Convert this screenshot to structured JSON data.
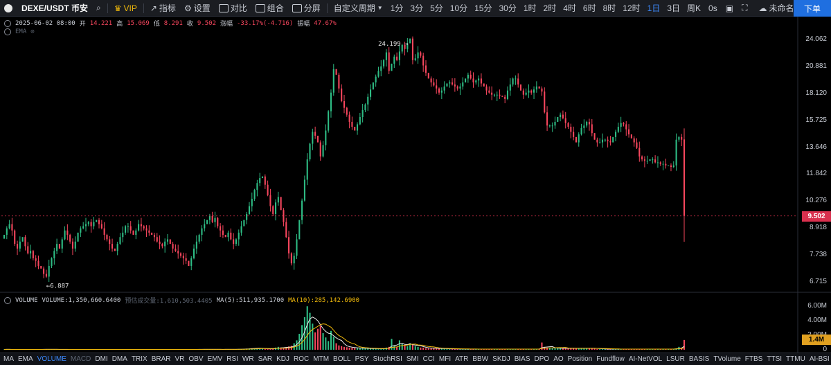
{
  "toolbar": {
    "symbol": "DEXE/USDT 币安",
    "vip": "VIP",
    "indicators": "指标",
    "settings": "设置",
    "compare": "对比",
    "combo": "组合",
    "split": "分屏",
    "custom_period": "自定义周期",
    "periods": [
      "1分",
      "3分",
      "5分",
      "10分",
      "15分",
      "30分",
      "1时",
      "2时",
      "4时",
      "6时",
      "8时",
      "12时",
      "1日",
      "3日",
      "周K"
    ],
    "active_period": "1日",
    "interval": "0s",
    "layout_name": "未命名",
    "order_button": "下单"
  },
  "ohlc": {
    "date": "2025-06-02 08:00",
    "open_label": "开",
    "open": "14.221",
    "high_label": "高",
    "high": "15.069",
    "low_label": "低",
    "low": "8.291",
    "close_label": "收",
    "close": "9.502",
    "change_label": "涨幅",
    "change": "-33.17%(-4.716)",
    "amplitude_label": "振幅",
    "amplitude": "47.67%"
  },
  "ema_label": "EMA",
  "volume_legend": {
    "title": "VOLUME",
    "volume": "VOLUME:1,350,660.6400",
    "est_volume": "预估成交量:1,610,503.4405",
    "ma5": "MA(5):511,935.1700",
    "ma10": "MA(10):285,142.6900"
  },
  "price_axis": [
    "24.062",
    "20.881",
    "18.120",
    "15.725",
    "13.646",
    "11.842",
    "10.276",
    "8.918",
    "7.738",
    "6.715"
  ],
  "current_price": "9.502",
  "volume_axis": [
    "6.00M",
    "4.00M",
    "2.00M",
    "0"
  ],
  "volume_tag": "1.4M",
  "annotations": {
    "high": "24.199",
    "low": "6.887"
  },
  "indicator_tabs": [
    "MA",
    "EMA",
    "VOLUME",
    "MACD",
    "DMI",
    "DMA",
    "TRIX",
    "BRAR",
    "VR",
    "OBV",
    "EMV",
    "RSI",
    "WR",
    "SAR",
    "KDJ",
    "ROC",
    "MTM",
    "BOLL",
    "PSY",
    "StochRSI",
    "SMI",
    "CCI",
    "MFI",
    "ATR",
    "BBW",
    "SKDJ",
    "BIAS",
    "DPO",
    "AO",
    "Position",
    "Fundflow",
    "AI-NetVOL",
    "LSUR",
    "BASIS",
    "TVolume",
    "FTBS",
    "TTSI",
    "TTMU",
    "AI-BSI"
  ],
  "active_indicator": "VOLUME",
  "dim_indicator": "MACD",
  "colors": {
    "up": "#2ebd85",
    "down": "#f6465d",
    "accent": "#3d8bff",
    "ma5": "#e8e8e8",
    "ma10": "#f0b90b",
    "price_tag": "#d9304e",
    "volume_tag": "#e0a020"
  },
  "chart_data": {
    "type": "candlestick",
    "y_scale": "log",
    "ylim": [
      6.4,
      26.0
    ],
    "volume_ylim": [
      0,
      6400000
    ],
    "closes": [
      8.6,
      8.9,
      9.1,
      8.8,
      8.2,
      8.0,
      8.3,
      8.5,
      8.1,
      7.8,
      7.9,
      7.6,
      7.5,
      7.3,
      7.2,
      7.0,
      6.9,
      7.3,
      7.6,
      7.9,
      8.2,
      8.0,
      8.4,
      8.8,
      8.6,
      8.3,
      8.0,
      8.3,
      8.7,
      8.9,
      9.0,
      9.1,
      9.2,
      9.0,
      9.2,
      9.3,
      9.1,
      8.9,
      8.6,
      8.4,
      8.2,
      8.0,
      7.9,
      8.2,
      8.5,
      8.7,
      9.0,
      9.0,
      8.8,
      8.6,
      8.8,
      9.1,
      9.0,
      8.9,
      8.8,
      8.7,
      8.6,
      8.5,
      8.3,
      8.2,
      8.1,
      8.3,
      8.4,
      8.2,
      8.0,
      7.9,
      7.8,
      7.7,
      7.6,
      7.5,
      7.3,
      7.6,
      8.0,
      8.3,
      8.6,
      8.9,
      9.1,
      9.3,
      9.5,
      9.2,
      9.4,
      9.0,
      8.8,
      8.6,
      8.5,
      8.7,
      8.4,
      8.2,
      8.4,
      8.7,
      9.0,
      9.3,
      9.6,
      10.0,
      10.4,
      10.9,
      11.3,
      11.6,
      11.7,
      11.2,
      10.6,
      10.0,
      9.6,
      10.2,
      10.5,
      9.8,
      9.2,
      8.5,
      7.8,
      7.4,
      7.7,
      8.4,
      9.3,
      10.3,
      11.5,
      12.8,
      13.9,
      14.8,
      14.5,
      14.0,
      13.0,
      13.8,
      14.9,
      16.5,
      18.2,
      20.6,
      20.0,
      18.6,
      17.4,
      16.8,
      16.2,
      15.6,
      15.2,
      14.9,
      15.4,
      16.0,
      16.6,
      17.1,
      17.8,
      18.5,
      19.2,
      19.8,
      20.4,
      20.9,
      21.6,
      22.5,
      20.4,
      21.2,
      22.0,
      21.6,
      22.6,
      23.4,
      22.9,
      23.6,
      24.2,
      21.6,
      21.8,
      22.5,
      22.1,
      21.0,
      20.2,
      19.6,
      19.2,
      18.9,
      18.6,
      18.2,
      18.4,
      18.8,
      19.1,
      19.2,
      19.0,
      18.8,
      18.6,
      18.8,
      19.2,
      19.6,
      20.0,
      19.6,
      19.2,
      19.4,
      19.6,
      19.1,
      18.8,
      18.4,
      18.2,
      18.0,
      18.0,
      18.0,
      17.9,
      17.8,
      17.6,
      18.4,
      19.0,
      19.6,
      19.6,
      19.0,
      18.4,
      18.0,
      18.2,
      18.4,
      18.2,
      18.5,
      18.8,
      18.6,
      18.3,
      16.4,
      15.3,
      15.3,
      15.3,
      15.6,
      16.0,
      16.2,
      15.9,
      15.5,
      15.2,
      14.8,
      14.4,
      14.0,
      14.6,
      15.1,
      15.3,
      15.6,
      15.4,
      14.7,
      14.2,
      14.0,
      14.0,
      14.2,
      14.2,
      14.1,
      14.0,
      14.4,
      14.8,
      15.2,
      15.5,
      15.4,
      15.0,
      14.6,
      14.3,
      14.0,
      13.6,
      13.0,
      12.8,
      12.7,
      12.7,
      12.8,
      12.8,
      12.6,
      12.6,
      12.5,
      12.5,
      12.4,
      12.4,
      12.3,
      12.4,
      14.2,
      14.4,
      14.2,
      9.502
    ],
    "volumes": [
      0.05,
      0.06,
      0.05,
      0.04,
      0.05,
      0.06,
      0.04,
      0.05,
      0.05,
      0.06,
      0.05,
      0.04,
      0.05,
      0.05,
      0.06,
      0.07,
      0.06,
      0.05,
      0.06,
      0.05,
      0.05,
      0.04,
      0.05,
      0.06,
      0.05,
      0.05,
      0.04,
      0.05,
      0.05,
      0.06,
      0.05,
      0.05,
      0.04,
      0.05,
      0.05,
      0.04,
      0.05,
      0.05,
      0.04,
      0.05,
      0.05,
      0.04,
      0.05,
      0.05,
      0.05,
      0.04,
      0.05,
      0.05,
      0.04,
      0.05,
      0.05,
      0.04,
      0.05,
      0.05,
      0.04,
      0.05,
      0.05,
      0.04,
      0.05,
      0.05,
      0.04,
      0.05,
      0.05,
      0.04,
      0.05,
      0.05,
      0.04,
      0.05,
      0.05,
      0.04,
      0.05,
      0.05,
      0.06,
      0.05,
      0.06,
      0.07,
      0.06,
      0.05,
      0.06,
      0.05,
      0.06,
      0.05,
      0.05,
      0.05,
      0.06,
      0.07,
      0.06,
      0.05,
      0.06,
      0.08,
      0.1,
      0.12,
      0.15,
      0.18,
      0.2,
      0.22,
      0.2,
      0.18,
      0.15,
      0.12,
      0.1,
      0.12,
      0.2,
      0.3,
      0.4,
      0.3,
      0.25,
      0.35,
      0.45,
      0.55,
      0.9,
      1.3,
      2.2,
      3.4,
      4.5,
      6.0,
      5.1,
      3.6,
      2.4,
      2.9,
      3.3,
      2.3,
      1.7,
      1.2,
      2.6,
      1.8,
      0.9,
      0.6,
      0.5,
      0.4,
      0.35,
      0.3,
      0.28,
      0.25,
      0.22,
      0.2,
      0.2,
      0.18,
      0.18,
      0.16,
      0.15,
      0.15,
      0.14,
      0.14,
      0.13,
      0.3,
      0.4,
      1.5,
      0.6,
      0.4,
      1.3,
      0.8,
      0.6,
      0.5,
      0.9,
      0.7,
      0.5,
      0.4,
      0.3,
      0.3,
      0.2,
      0.2,
      0.2,
      0.2,
      0.2,
      0.15,
      0.15,
      0.15,
      0.12,
      0.12,
      0.12,
      0.1,
      0.1,
      0.1,
      0.1,
      0.1,
      0.1,
      0.1,
      0.1,
      0.1,
      0.1,
      0.1,
      0.1,
      0.1,
      0.1,
      0.1,
      0.1,
      0.1,
      0.1,
      0.1,
      0.1,
      0.1,
      0.1,
      0.1,
      0.1,
      0.1,
      0.1,
      0.1,
      0.1,
      0.1,
      0.1,
      0.1,
      0.1,
      0.1,
      1.0,
      0.4,
      0.3,
      0.3,
      0.2,
      0.2,
      0.2,
      0.2,
      0.2,
      0.2,
      0.2,
      0.2,
      0.2,
      0.2,
      0.2,
      0.2,
      0.2,
      0.2,
      0.2,
      0.2,
      0.2,
      0.1,
      0.1,
      0.1,
      0.1,
      0.1,
      0.1,
      0.1,
      0.1,
      0.1,
      0.1,
      0.1,
      0.1,
      0.1,
      0.1,
      0.1,
      0.1,
      0.1,
      0.1,
      0.1,
      0.1,
      0.1,
      0.1,
      0.1,
      0.1,
      0.1,
      0.1,
      0.1,
      0.1,
      0.1,
      0.1,
      0.2,
      0.4,
      0.3,
      1.35
    ]
  }
}
